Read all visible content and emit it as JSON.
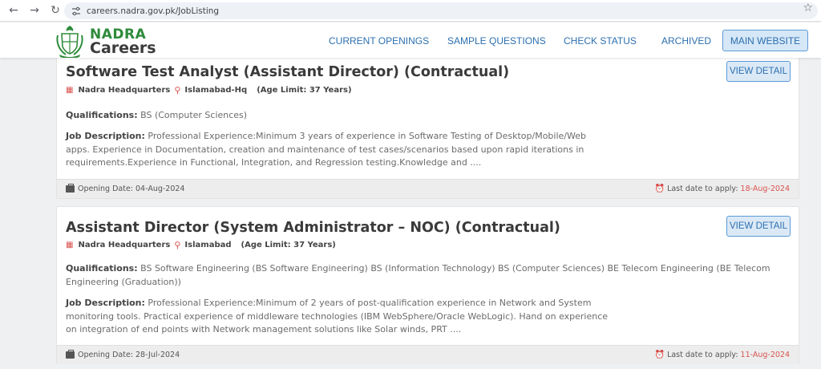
{
  "browser": {
    "url": "careers.nadra.gov.pk/JobListing",
    "icons": [
      "back-icon",
      "forward-icon",
      "reload-icon",
      "site-info-icon",
      "bookmark-star-icon"
    ]
  },
  "header": {
    "logo_top": "NADRA",
    "logo_bottom": "Careers",
    "nav": [
      "CURRENT OPENINGS",
      "SAMPLE QUESTIONS",
      "CHECK STATUS",
      "ARCHIVED"
    ],
    "main_website_label": "MAIN WEBSITE",
    "colors": {
      "brand_green": "#2e8b3a",
      "link_blue": "#2c6fb0",
      "button_bg": "#d6e7f7"
    }
  },
  "jobs": [
    {
      "title": "Software Test Analyst (Assistant Director) (Contractual)",
      "office": "Nadra Headquarters",
      "location": "Islamabad-Hq",
      "age_limit": "(Age Limit: 37 Years)",
      "view_label": "VIEW DETAIL",
      "qualifications_label": "Qualifications:",
      "qualifications": "BS (Computer Sciences)",
      "description_label": "Job Description:",
      "description_lines": [
        "Professional Experience:Minimum 3 years of experience in Software Testing of Desktop/Mobile/Web",
        "apps.  Experience in Documentation, creation and maintenance of test cases/scenarios based upon rapid iterations in",
        "requirements.Experience in Functional, Integration, and Regression testing.Knowledge and ...."
      ],
      "opening_date": "Opening Date: 04-Aug-2024",
      "last_date_label": "Last date to apply:",
      "last_date": "18-Aug-2024"
    },
    {
      "title": "Assistant Director (System Administrator – NOC) (Contractual)",
      "office": "Nadra Headquarters",
      "location": "Islamabad",
      "age_limit": "(Age Limit: 37 Years)",
      "view_label": "VIEW DETAIL",
      "qualifications_label": "Qualifications:",
      "qualifications_lines": [
        "BS Software Engineering (BS Software Engineering) BS (Information Technology) BS (Computer Sciences) BE Telecom Engineering (BE Telecom",
        "Engineering (Graduation))"
      ],
      "description_label": "Job Description:",
      "description_lines": [
        "Professional Experience:Minimum of 2 years of post-qualification experience in Network and System",
        "monitoring tools. Practical experience of middleware technologies (IBM WebSphere/Oracle WebLogic). Hand on experience",
        "on integration of end points with Network management solutions like Solar winds, PRT ...."
      ],
      "opening_date": "Opening Date: 28-Jul-2024",
      "last_date_label": "Last date to apply:",
      "last_date": "11-Aug-2024"
    }
  ]
}
